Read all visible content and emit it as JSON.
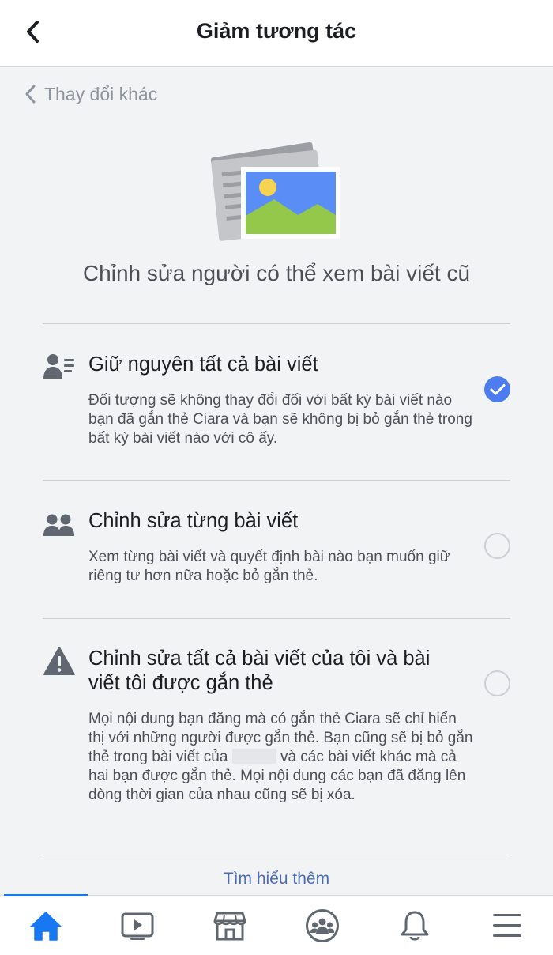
{
  "header": {
    "title": "Giảm tương tác"
  },
  "sub_nav": {
    "back_label": "Thay đổi khác"
  },
  "page_heading": "Chỉnh sửa người có thể xem bài viết cũ",
  "options": [
    {
      "title": "Giữ nguyên tất cả bài viết",
      "description": "Đối tượng sẽ không thay đổi đối với bất kỳ bài viết nào bạn đã gắn thẻ Ciara và bạn sẽ không bị bỏ gắn thẻ trong bất kỳ bài viết nào với cô ấy.",
      "icon": "person-list-icon",
      "selected": true
    },
    {
      "title": "Chỉnh sửa từng bài viết",
      "description": "Xem từng bài viết và quyết định bài nào bạn muốn giữ riêng tư hơn nữa hoặc bỏ gắn thẻ.",
      "icon": "people-icon",
      "selected": false
    },
    {
      "title": "Chỉnh sửa tất cả bài viết của tôi và bài viết tôi được gắn thẻ",
      "description_before": "Mọi nội dung bạn đăng mà có gắn thẻ Ciara sẽ chỉ hiển thị với những người được gắn thẻ. Bạn cũng sẽ bị bỏ gắn thẻ trong bài viết của",
      "description_after": "và các bài viết khác mà cả hai bạn được gắn thẻ. Mọi nội dung các bạn đã đăng lên dòng thời gian của nhau cũng sẽ bị xóa.",
      "icon": "warning-icon",
      "selected": false
    }
  ],
  "learn_more": "Tìm hiểu thêm",
  "tabs": [
    {
      "name": "home",
      "icon": "home-icon",
      "active": true
    },
    {
      "name": "watch",
      "icon": "video-icon",
      "active": false
    },
    {
      "name": "marketplace",
      "icon": "marketplace-icon",
      "active": false
    },
    {
      "name": "groups",
      "icon": "groups-icon",
      "active": false
    },
    {
      "name": "notifications",
      "icon": "bell-icon",
      "active": false
    },
    {
      "name": "menu",
      "icon": "menu-icon",
      "active": false
    }
  ],
  "colors": {
    "accent": "#1877f2",
    "radio_selected": "#4c7cf0",
    "icon_gray": "#606770",
    "background": "#f2f3f5"
  }
}
